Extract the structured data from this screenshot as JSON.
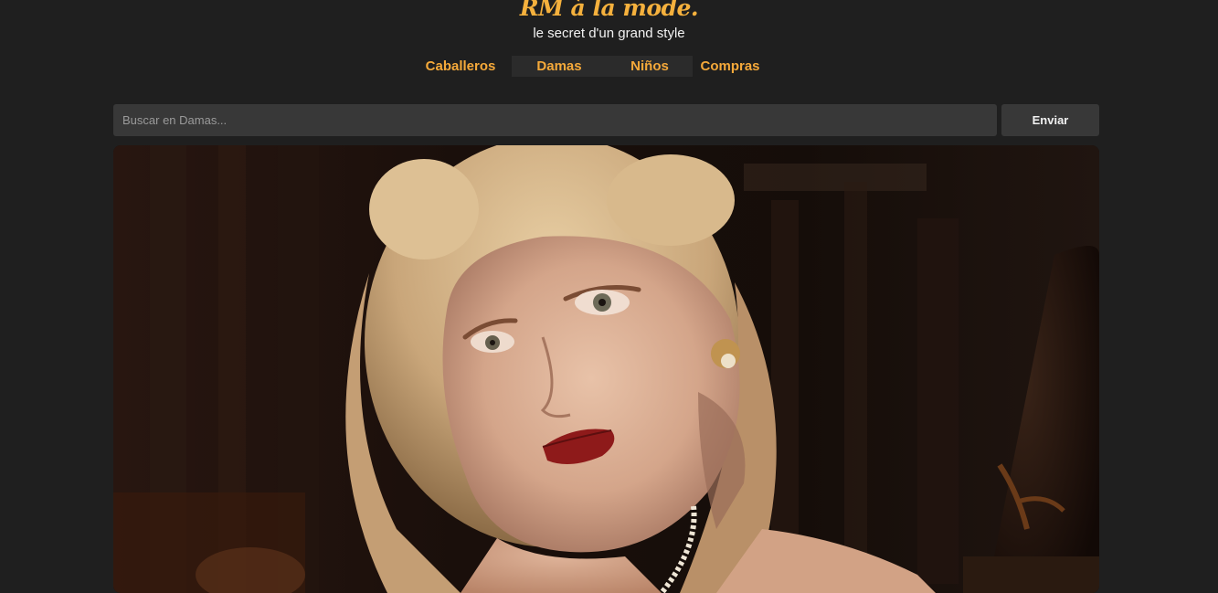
{
  "header": {
    "brand_title": "RM à la mode.",
    "tagline": "le secret d'un grand style"
  },
  "nav": {
    "items": [
      {
        "label": "Caballeros",
        "active": false
      },
      {
        "label": "Damas",
        "active": true
      },
      {
        "label": "Niños",
        "active": false
      },
      {
        "label": "Compras",
        "active": false
      }
    ]
  },
  "search": {
    "placeholder": "Buscar en Damas...",
    "value": "",
    "submit_label": "Enviar"
  },
  "colors": {
    "page_background": "#1f1f1f",
    "accent": "#f5b13d",
    "control_background": "#383838",
    "tagline": "#f2f2f2"
  }
}
